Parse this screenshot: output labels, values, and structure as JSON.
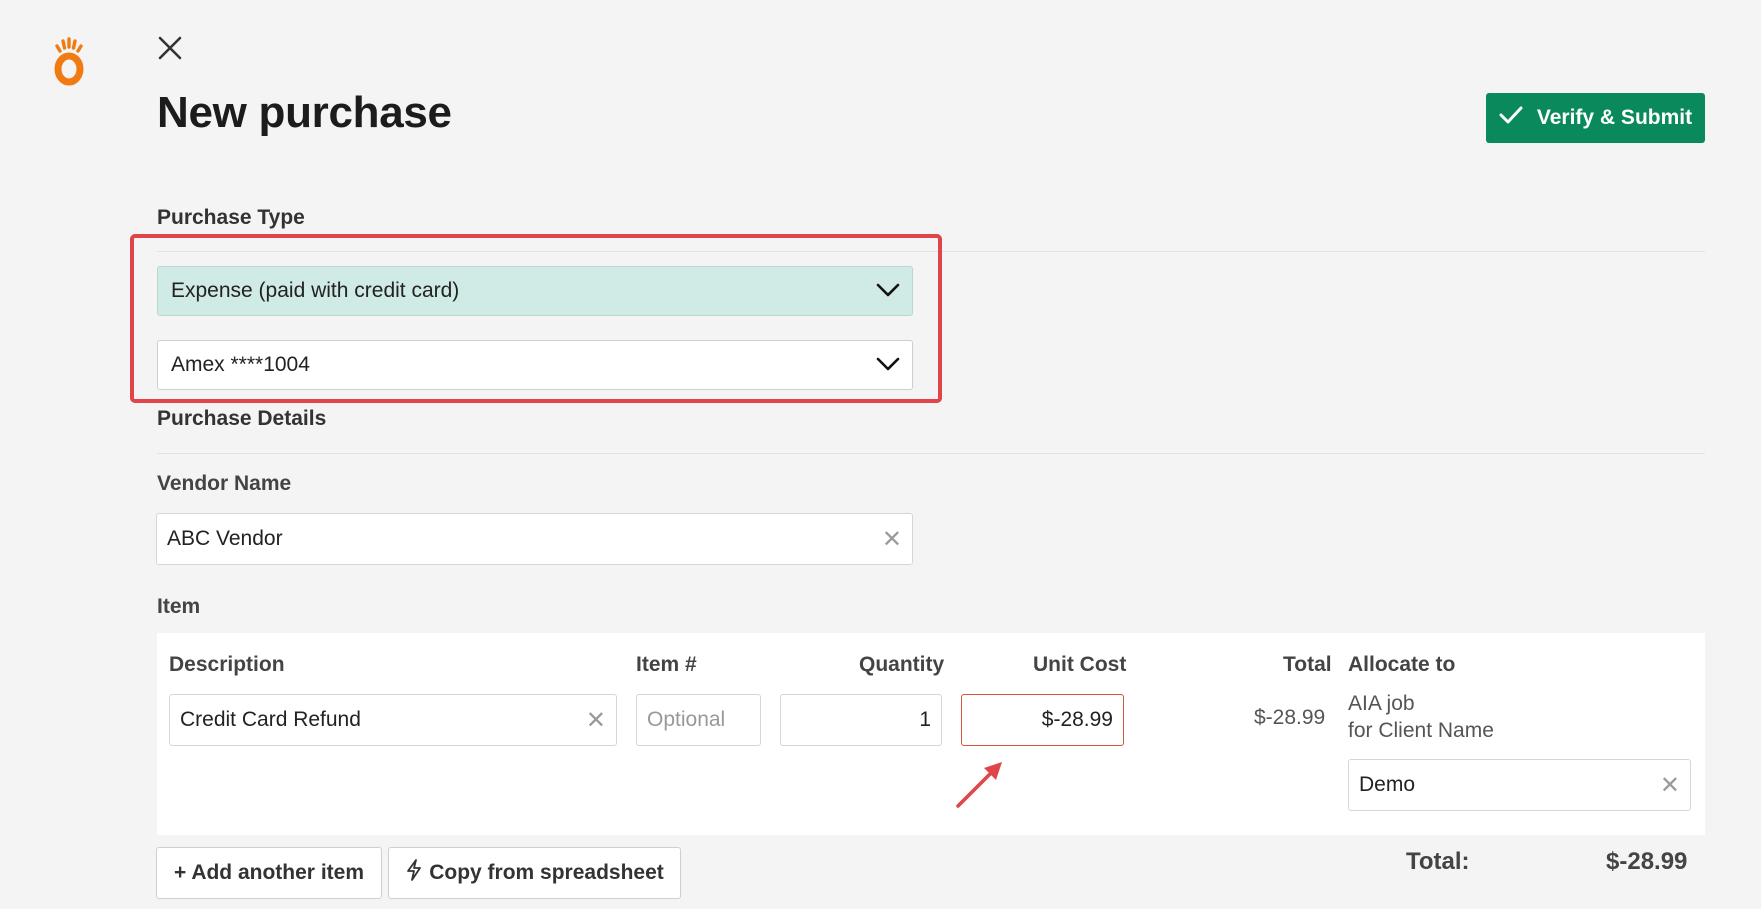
{
  "page": {
    "title": "New purchase"
  },
  "toolbar": {
    "verify_label": "Verify & Submit"
  },
  "purchase_type": {
    "section_label": "Purchase Type",
    "type_selected": "Expense (paid with credit card)",
    "card_selected": "Amex ****1004"
  },
  "purchase_details": {
    "section_label": "Purchase Details",
    "vendor_label": "Vendor Name",
    "vendor_value": "ABC Vendor"
  },
  "items": {
    "section_label": "Item",
    "columns": {
      "description": "Description",
      "item_no": "Item #",
      "quantity": "Quantity",
      "unit_cost": "Unit Cost",
      "total": "Total",
      "allocate_to": "Allocate to"
    },
    "row": {
      "description": "Credit Card Refund",
      "item_no_placeholder": "Optional",
      "quantity": "1",
      "unit_cost": "$-28.99",
      "total": "$-28.99",
      "allocate_line1": "AIA job",
      "allocate_line2": "for Client Name",
      "allocate_value": "Demo"
    }
  },
  "actions": {
    "add_item_label": "+ Add another item",
    "copy_label": "Copy from spreadsheet"
  },
  "summary": {
    "total_label": "Total:",
    "total_value": "$-28.99"
  },
  "colors": {
    "brand": "#f07b12",
    "accent_green": "#0a8a5c",
    "highlight_red": "#e0454a",
    "teal_select": "#d0eae5"
  }
}
